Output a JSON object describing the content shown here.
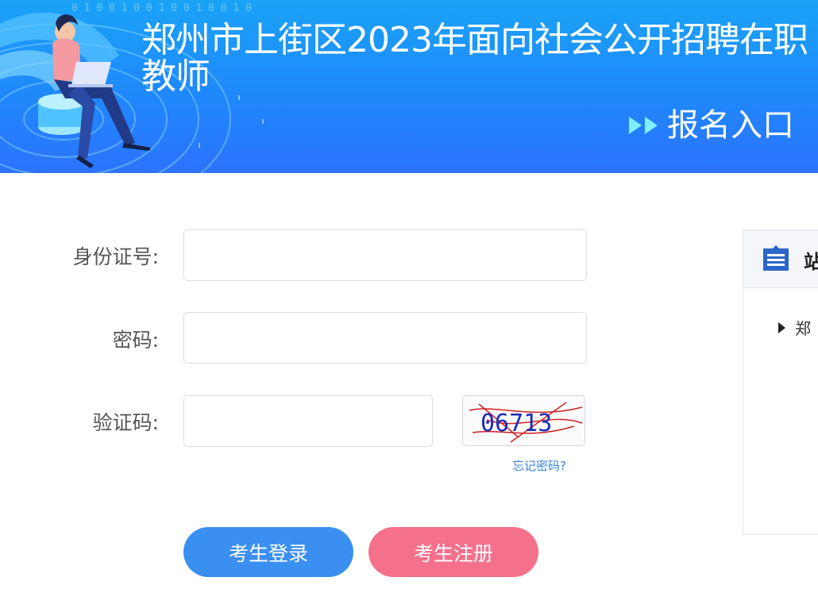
{
  "banner": {
    "title": "郑州市上街区2023年面向社会公开招聘在职教师",
    "entry_label": "报名入口",
    "deco_digits": "0 1 0 0 1 0 0 1 0 0 1 0 0 1 0"
  },
  "form": {
    "id_label": "身份证号:",
    "id_value": "",
    "password_label": "密码:",
    "password_value": "",
    "captcha_label": "验证码:",
    "captcha_value": "",
    "captcha_image_text": "06713",
    "forgot_link": "忘记密码?"
  },
  "buttons": {
    "login": "考生登录",
    "register": "考生注册"
  },
  "notice_panel": {
    "title": "站",
    "items": [
      {
        "text": "郑"
      }
    ]
  },
  "colors": {
    "banner_top": "#1aa3f7",
    "banner_bottom": "#2c73fd",
    "login_button": "#3b8ff0",
    "register_button": "#f5708b",
    "link": "#3a84d6"
  }
}
